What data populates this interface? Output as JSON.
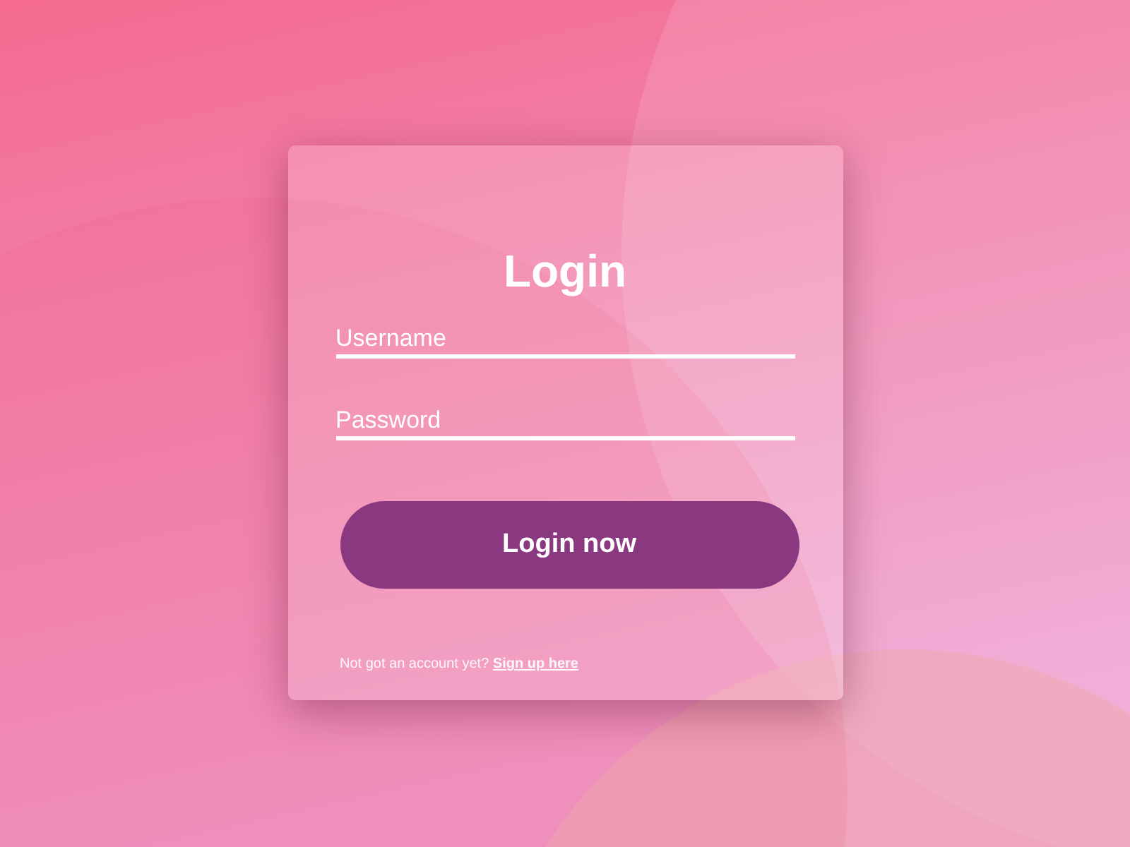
{
  "title": "Login",
  "fields": [
    {
      "placeholder": "Username"
    },
    {
      "placeholder": "Password"
    }
  ],
  "button": "Login now",
  "footer": {
    "text": "Not got an account yet?",
    "link": "Sign up here"
  }
}
